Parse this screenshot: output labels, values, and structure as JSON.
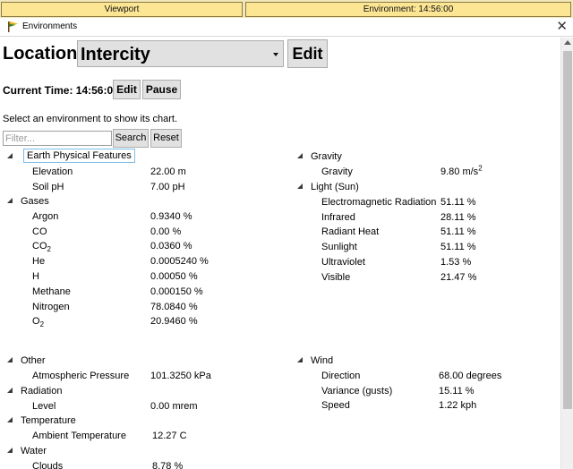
{
  "tabs": {
    "viewport": "Viewport",
    "environment": "Environment: 14:56:00"
  },
  "window": {
    "title": "Environments",
    "close": "✕"
  },
  "location": {
    "label": "Location:",
    "selected": "Intercity",
    "edit_label": "Edit"
  },
  "time": {
    "label": "Current Time: 14:56:00",
    "edit_label": "Edit",
    "pause_label": "Pause"
  },
  "instruction": "Select an environment to show its chart.",
  "filter": {
    "placeholder": "Filter...",
    "value": "",
    "search_label": "Search",
    "reset_label": "Reset"
  },
  "groups": [
    {
      "name": "Earth Physical Features",
      "rows": [
        {
          "name": "Elevation",
          "value": "22.00 m"
        },
        {
          "name": "Soil pH",
          "value": "7.00 pH"
        }
      ]
    },
    {
      "name": "Gases",
      "rows": [
        {
          "name": "Argon",
          "value": "0.9340 %"
        },
        {
          "name": "CO",
          "value": "0.00 %"
        },
        {
          "name": "CO",
          "sub": "2",
          "value": "0.0360 %"
        },
        {
          "name": "He",
          "value": "0.0005240 %"
        },
        {
          "name": "H",
          "value": "0.00050 %"
        },
        {
          "name": "Methane",
          "value": "0.000150 %"
        },
        {
          "name": "Nitrogen",
          "value": "78.0840 %"
        },
        {
          "name": "O",
          "sub": "2",
          "value": "20.9460 %"
        }
      ]
    },
    {
      "name": "Gravity",
      "rows": [
        {
          "name": "Gravity",
          "value": "9.80 m/s",
          "sup": "2"
        }
      ]
    },
    {
      "name": "Light (Sun)",
      "rows": [
        {
          "name": "Electromagnetic Radiation",
          "value": "51.11 %"
        },
        {
          "name": "Infrared",
          "value": "28.11 %"
        },
        {
          "name": "Radiant Heat",
          "value": "51.11 %"
        },
        {
          "name": "Sunlight",
          "value": "51.11 %"
        },
        {
          "name": "Ultraviolet",
          "value": "1.53 %"
        },
        {
          "name": "Visible",
          "value": "21.47 %"
        }
      ]
    },
    {
      "name": "Other",
      "rows": [
        {
          "name": "Atmospheric Pressure",
          "value": "101.3250 kPa"
        }
      ]
    },
    {
      "name": "Radiation",
      "rows": [
        {
          "name": "Level",
          "value": "0.00 mrem"
        }
      ]
    },
    {
      "name": "Temperature",
      "rows": [
        {
          "name": "Ambient Temperature",
          "value": "12.27 C"
        }
      ]
    },
    {
      "name": "Water",
      "rows": [
        {
          "name": "Clouds",
          "value": "8.78 %"
        }
      ]
    },
    {
      "name": "Wind",
      "rows": [
        {
          "name": "Direction",
          "value": "68.00 degrees"
        },
        {
          "name": "Variance (gusts)",
          "value": "15.11 %"
        },
        {
          "name": "Speed",
          "value": "1.22 kph"
        }
      ]
    }
  ]
}
